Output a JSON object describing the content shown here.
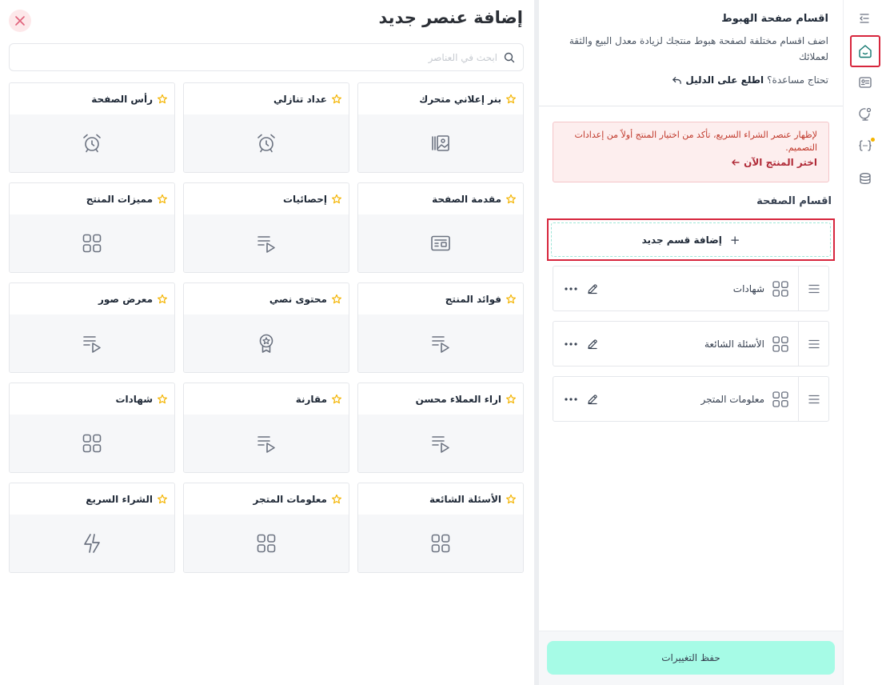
{
  "add_panel": {
    "title": "إضافة عنصر جديد",
    "search_placeholder": "ابحث في العناصر",
    "cards": [
      {
        "label": "بنر إعلاني متحرك",
        "icon": "gallery-icon"
      },
      {
        "label": "عداد تنازلي",
        "icon": "alarm-clock-icon"
      },
      {
        "label": "رأس الصفحة",
        "icon": "alarm-clock-icon"
      },
      {
        "label": "مقدمة الصفحة",
        "icon": "id-card-icon"
      },
      {
        "label": "إحصائيات",
        "icon": "playlist-icon"
      },
      {
        "label": "مميزات المنتج",
        "icon": "grid-icon"
      },
      {
        "label": "فوائد المنتج",
        "icon": "playlist-icon"
      },
      {
        "label": "محتوى نصي",
        "icon": "award-icon"
      },
      {
        "label": "معرض صور",
        "icon": "playlist-icon"
      },
      {
        "label": "اراء العملاء محسن",
        "icon": "playlist-icon"
      },
      {
        "label": "مقارنة",
        "icon": "playlist-icon"
      },
      {
        "label": "شهادات",
        "icon": "grid-icon"
      },
      {
        "label": "الأسئلة الشائعة",
        "icon": "grid-icon"
      },
      {
        "label": "معلومات المتجر",
        "icon": "grid-icon"
      },
      {
        "label": "الشراء السريع",
        "icon": "lightning-icon"
      }
    ]
  },
  "sections_panel": {
    "title": "اقسام صفحة الهبوط",
    "description": "اضف اقسام مختلفة لصفحة هبوط منتجك لزيادة معدل البيع والثقة لعملائك",
    "help_text": "تحتاج مساعدة؟",
    "guide_link": "اطلع على الدليل",
    "alert_text": "لإظهار عنصر الشراء السريع، تأكد من اختيار المنتج أولاً من إعدادات التصميم.",
    "alert_link": "اختر المنتج الآن",
    "sections_label": "اقسام الصفحة",
    "add_section": "إضافة قسم جديد",
    "sections": [
      {
        "name": "شهادات"
      },
      {
        "name": "الأسئلة الشائعة"
      },
      {
        "name": "معلومات المتجر"
      }
    ],
    "save_button": "حفظ التغييرات"
  },
  "rail": {
    "items": [
      "collapse-menu-icon",
      "home-icon",
      "id-card-icon",
      "settings-globe-icon",
      "code-braces-icon",
      "database-icon"
    ],
    "active": "home-icon",
    "dot_item": "code-braces-icon",
    "dot_color": "#f4b400"
  },
  "colors": {
    "accent_red": "#d7263d",
    "save_bg": "#a6fbe6",
    "star": "#f4b400",
    "alert_text": "#c0392b"
  }
}
